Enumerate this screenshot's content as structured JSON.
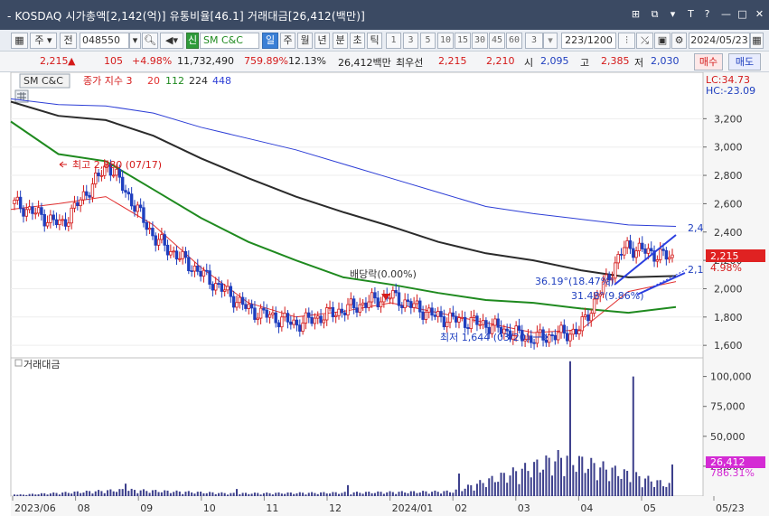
{
  "titlebar": {
    "title": "- KOSDAQ 시가총액[2,142(억)] 유통비율[46.1] 거래대금[26,412(백만)]",
    "buttons": [
      "⊞",
      "⧉",
      "▾",
      "T",
      "?",
      "—",
      "□",
      "✕"
    ]
  },
  "toolbar": {
    "period_type": "주",
    "all_button": "전",
    "stock_code": "048550",
    "new_badge": "신",
    "stock_name": "SM C&C",
    "periods": [
      "일",
      "주",
      "월",
      "년",
      "분",
      "초",
      "틱"
    ],
    "active_period": "일",
    "intervals": [
      "1",
      "3",
      "5",
      "10",
      "15",
      "30",
      "45",
      "60"
    ],
    "interval_value": "3",
    "range": "223/1200",
    "date": "2024/05/23"
  },
  "quote": {
    "price": "2,215",
    "change_arrow": "▲",
    "change": "105",
    "change_pct": "+4.98%",
    "volume": "11,732,490",
    "volume_ratio": "759.89%",
    "turnover": "12.13%",
    "amount": "26,412백만",
    "best_ask_label": "최우선",
    "best_ask": "2,215",
    "best_bid": "2,210",
    "open_label": "시",
    "open": "2,095",
    "high_label": "고",
    "high": "2,385",
    "low_label": "저",
    "low": "2,030",
    "buy_label": "매수",
    "sell_label": "매도"
  },
  "chart": {
    "name_box": "SM C&C",
    "indicator_label": "종가 지수 3",
    "ma_periods": [
      "20",
      "112",
      "224",
      "448"
    ],
    "lc_label": "LC:34.73",
    "hc_label": "HC:-23.09",
    "price_axis_ticks": [
      "3,200",
      "3,000",
      "2,800",
      "2,600",
      "2,400",
      "2,200",
      "2,000",
      "1,800",
      "1,600"
    ],
    "current_price_tag": "2,215",
    "current_pct_tag": "4.98%",
    "high_annotation": "최고 2,880 (07/17)",
    "low_annotation": "최저 1,644 (03/20)",
    "dividend_annotation": "배당락(0.00%)",
    "angle_annotation_1": "36.19°(18.47%)",
    "angle_annotation_2": "31.48°(9.86%)",
    "trend_label_1": "2,4",
    "trend_label_2": "2,1",
    "volume_panel_label": "거래대금",
    "volume_axis_ticks": [
      "100,000",
      "75,000",
      "50,000",
      "25,000"
    ],
    "volume_tag": "26,412",
    "volume_pct_tag": "786.31%",
    "x_axis_labels": [
      "2023/06",
      "08",
      "09",
      "10",
      "11",
      "12",
      "2024/01",
      "02",
      "03",
      "04",
      "05",
      "05/23"
    ]
  },
  "colors": {
    "up": "#d41a1a",
    "down": "#1f3fbf",
    "ma20": "#e23131",
    "ma112": "#1f8a1f",
    "ma224": "#2b2b2b",
    "ma448": "#2d3ed6",
    "volume_bar": "#3c3f8c",
    "price_tag": "#e02222",
    "volume_tag": "#d42bd4"
  },
  "chart_data": {
    "type": "line",
    "ylim": [
      1550,
      3400
    ],
    "ylim_volume": [
      0,
      105000
    ],
    "series": [
      {
        "name": "종가",
        "x": [
          "2023/06",
          "2023/07",
          "2023/07/17",
          "2023/08",
          "2023/09",
          "2023/10",
          "2023/11",
          "2023/12",
          "2024/01",
          "2024/02",
          "2024/03",
          "2024/03/20",
          "2024/04",
          "2024/05",
          "2024/05/23"
        ],
        "values": [
          2600,
          2450,
          2880,
          2350,
          2100,
          1850,
          1750,
          1850,
          1950,
          1800,
          1750,
          1644,
          1700,
          2300,
          2215
        ]
      },
      {
        "name": "20",
        "values": [
          2560,
          2600,
          2650,
          2450,
          2150,
          1900,
          1800,
          1840,
          1900,
          1830,
          1760,
          1690,
          1710,
          1980,
          2050
        ]
      },
      {
        "name": "112",
        "values": [
          3180,
          2950,
          2900,
          2700,
          2500,
          2330,
          2200,
          2080,
          2030,
          1970,
          1920,
          1900,
          1860,
          1830,
          1870
        ]
      },
      {
        "name": "224",
        "values": [
          3320,
          3220,
          3190,
          3080,
          2920,
          2780,
          2650,
          2540,
          2440,
          2330,
          2250,
          2200,
          2130,
          2080,
          2090
        ]
      },
      {
        "name": "448",
        "values": [
          3340,
          3300,
          3290,
          3240,
          3140,
          3060,
          2980,
          2880,
          2780,
          2680,
          2580,
          2530,
          2490,
          2450,
          2440
        ]
      }
    ],
    "volume": {
      "name": "거래대금",
      "x": [
        "2023/06",
        "2023/07/17",
        "2023/12",
        "2024/01",
        "2024/04",
        "2024/05",
        "2024/05/23"
      ],
      "values": [
        3000,
        16000,
        7000,
        9000,
        12000,
        100000,
        26412
      ]
    }
  }
}
